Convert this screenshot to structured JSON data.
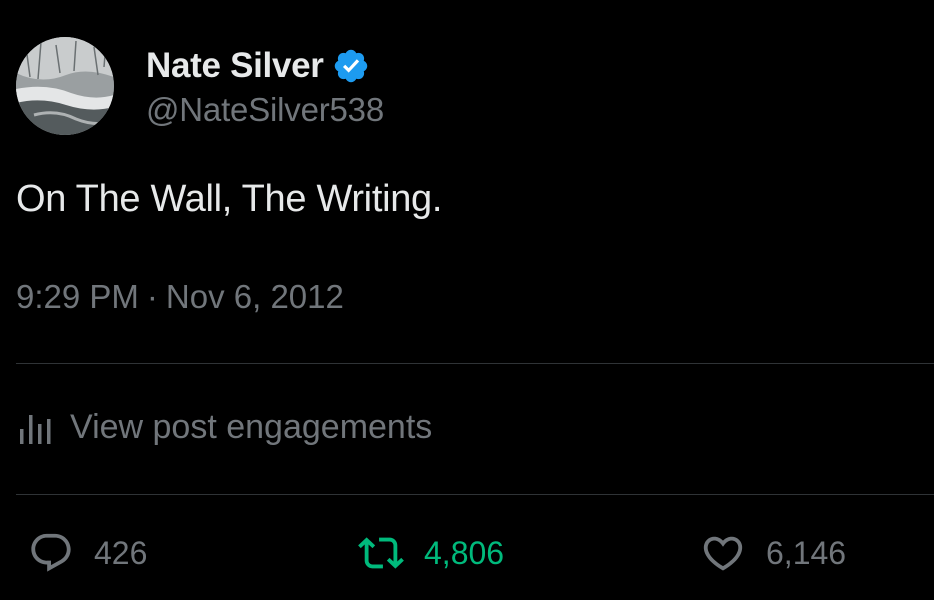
{
  "author": {
    "display_name": "Nate Silver",
    "handle": "@NateSilver538",
    "verified": true,
    "verified_color": "#1d9bf0"
  },
  "post": {
    "text": "On The Wall, The Writing.",
    "time": "9:29 PM",
    "separator": "·",
    "date": "Nov 6, 2012"
  },
  "engagements": {
    "label": "View post engagements",
    "icon": "analytics-bars-icon"
  },
  "actions": {
    "reply": {
      "icon": "reply-bubble-icon",
      "count": "426"
    },
    "repost": {
      "icon": "repost-arrows-icon",
      "count": "4,806",
      "color": "#00ba7c",
      "active": true
    },
    "like": {
      "icon": "heart-icon",
      "count": "6,146"
    }
  },
  "colors": {
    "background": "#000000",
    "primary_text": "#e7e9ea",
    "secondary_text": "#71767b",
    "divider": "#2f3336"
  }
}
